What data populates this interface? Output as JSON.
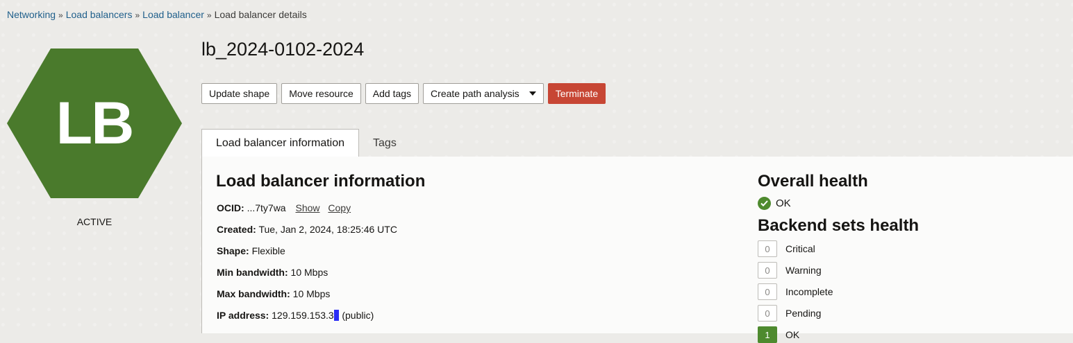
{
  "breadcrumb": {
    "items": [
      "Networking",
      "Load balancers",
      "Load balancer"
    ],
    "current": "Load balancer details"
  },
  "badge": {
    "initials": "LB",
    "status": "ACTIVE",
    "color": "#4a7a2c"
  },
  "title": "lb_2024-0102-2024",
  "actions": {
    "update_shape": "Update shape",
    "move_resource": "Move resource",
    "add_tags": "Add tags",
    "create_path_analysis": "Create path analysis",
    "terminate": "Terminate"
  },
  "tabs": [
    "Load balancer information",
    "Tags"
  ],
  "info": {
    "heading": "Load balancer information",
    "ocid_label": "OCID:",
    "ocid_value": "...7ty7wa",
    "show_link": "Show",
    "copy_link": "Copy",
    "created_label": "Created:",
    "created_value": "Tue, Jan 2, 2024, 18:25:46 UTC",
    "shape_label": "Shape:",
    "shape_value": "Flexible",
    "min_bw_label": "Min bandwidth:",
    "min_bw_value": "10 Mbps",
    "max_bw_label": "Max bandwidth:",
    "max_bw_value": "10 Mbps",
    "ip_label": "IP address:",
    "ip_value_prefix": "129.159.153.3",
    "ip_value_hidden": "3",
    "ip_value_suffix": " (public)"
  },
  "health": {
    "overall_heading": "Overall health",
    "overall_status": "OK",
    "backend_heading": "Backend sets health",
    "rows": [
      {
        "count": "0",
        "label": "Critical"
      },
      {
        "count": "0",
        "label": "Warning"
      },
      {
        "count": "0",
        "label": "Incomplete"
      },
      {
        "count": "0",
        "label": "Pending"
      },
      {
        "count": "1",
        "label": "OK"
      }
    ]
  }
}
